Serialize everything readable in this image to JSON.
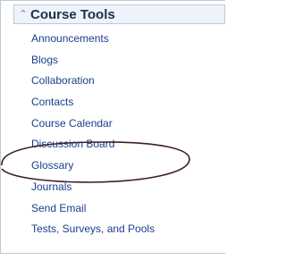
{
  "sidebar": {
    "title": "Course Tools",
    "toggle_icon": "collapse-up-icon",
    "items": [
      {
        "label": "Announcements"
      },
      {
        "label": "Blogs"
      },
      {
        "label": "Collaboration"
      },
      {
        "label": "Contacts"
      },
      {
        "label": "Course Calendar"
      },
      {
        "label": "Discussion Board"
      },
      {
        "label": "Glossary"
      },
      {
        "label": "Journals"
      },
      {
        "label": "Send Email"
      },
      {
        "label": "Tests, Surveys, and Pools"
      }
    ]
  },
  "colors": {
    "link": "#1b3d8f",
    "header_bg": "#eef3fb",
    "header_border": "#b9c8df",
    "highlight_ellipse": "#3a1f2e"
  }
}
